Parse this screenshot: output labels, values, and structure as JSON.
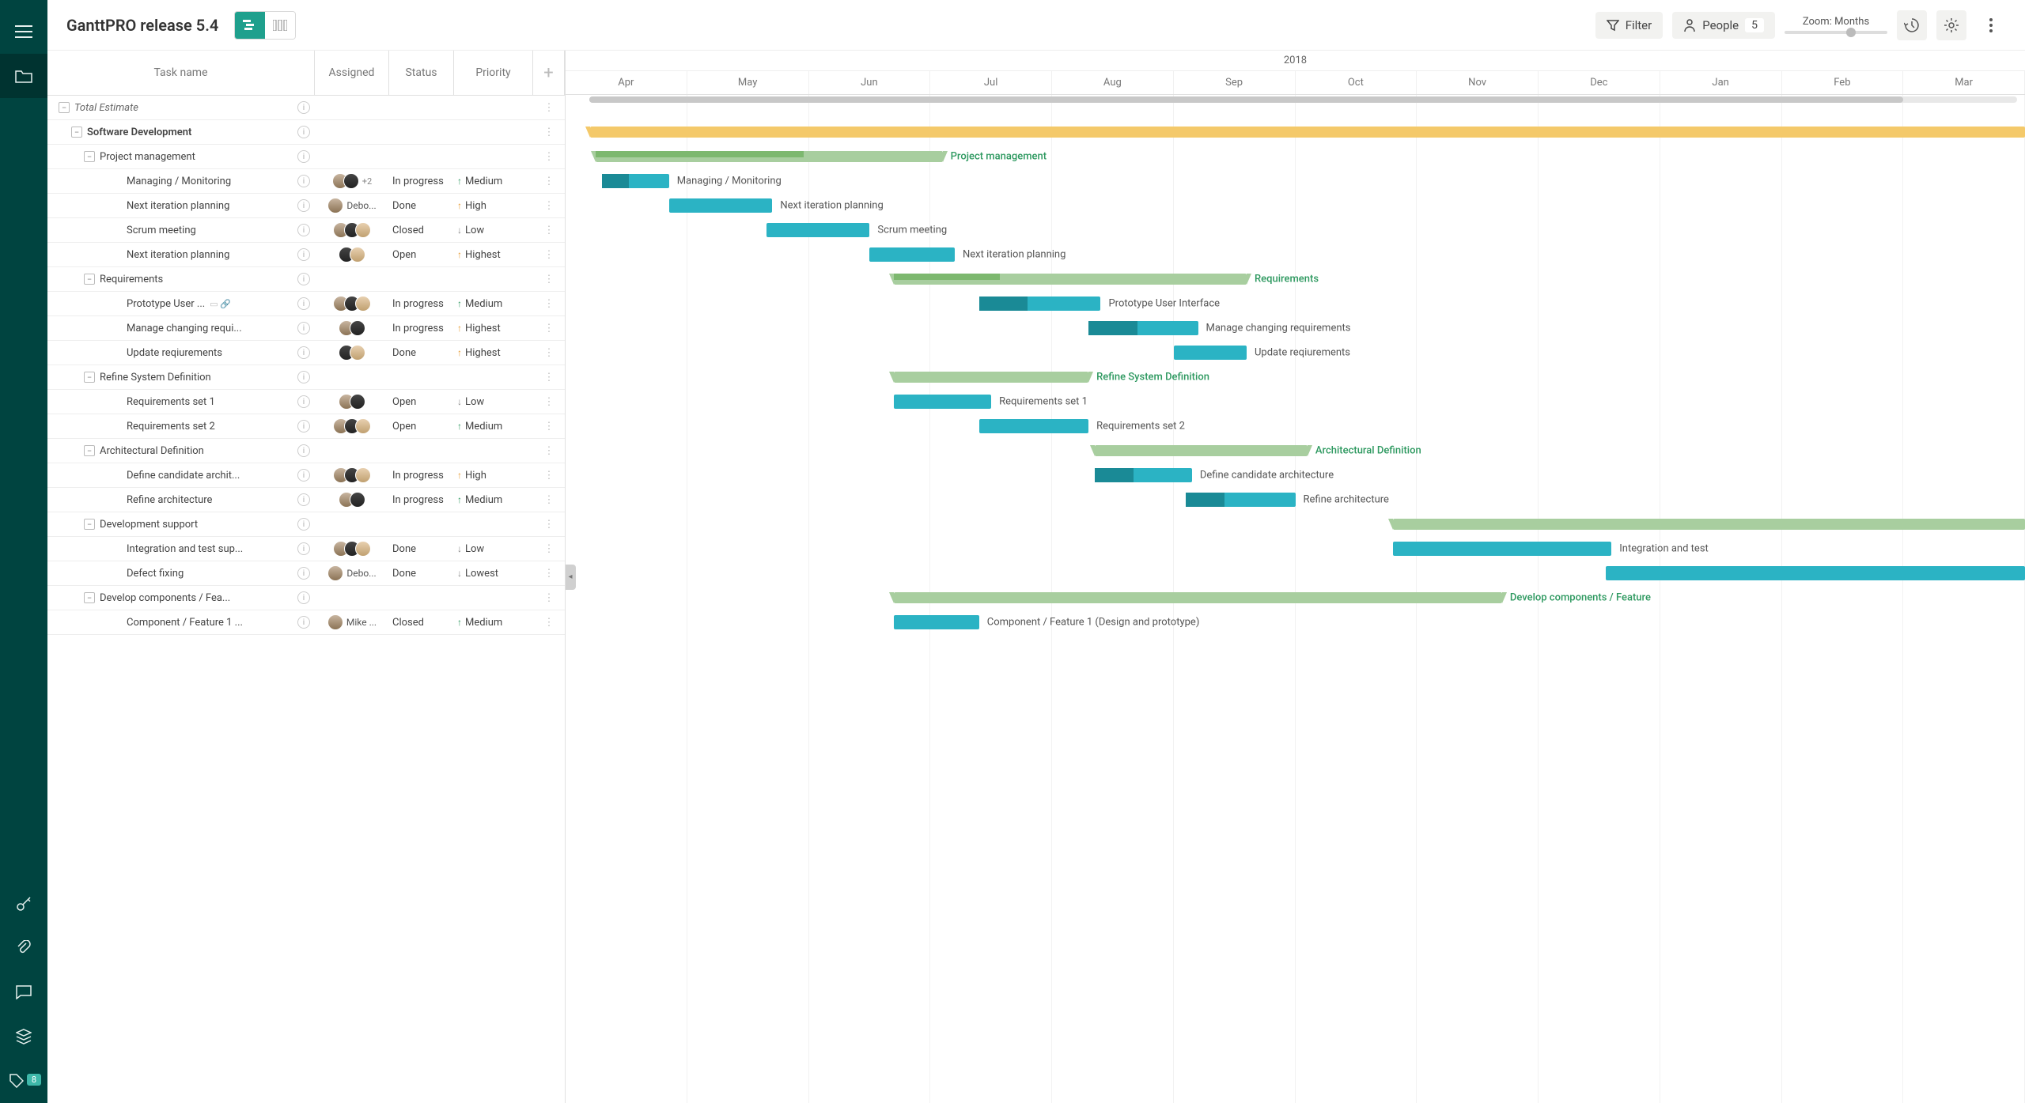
{
  "project_title": "GanttPRO release 5.4",
  "topbar": {
    "filter": "Filter",
    "people": "People",
    "people_count": "5",
    "zoom_label": "Zoom: Months"
  },
  "sidebar": {
    "badge": "8"
  },
  "columns": {
    "name": "Task name",
    "assigned": "Assigned",
    "status": "Status",
    "priority": "Priority"
  },
  "timeline": {
    "year": "2018",
    "months": [
      "Apr",
      "May",
      "Jun",
      "Jul",
      "Aug",
      "Sep",
      "Oct",
      "Nov",
      "Dec",
      "Jan",
      "Feb",
      "Mar"
    ]
  },
  "chart_data": {
    "type": "gantt",
    "time_axis": {
      "start_month": "Apr 2018",
      "end_month": "Mar 2019",
      "num_cols": 12
    },
    "rows": [
      {
        "id": "total",
        "name": "Total Estimate",
        "indent": 0,
        "type": "scrollbar"
      },
      {
        "id": "soft",
        "name": "Software Development",
        "indent": 1,
        "type": "summary-yellow",
        "start": 0.2,
        "end": 12,
        "progress": 0.55
      },
      {
        "id": "pm",
        "name": "Project management",
        "indent": 2,
        "type": "summary-green",
        "start": 0.25,
        "end": 3.1,
        "progress": 0.6,
        "label_class": "green"
      },
      {
        "id": "mm",
        "name": "Managing / Monitoring",
        "indent": 3,
        "assigned": [
          "a1",
          "a2",
          "+2"
        ],
        "status": "In progress",
        "priority": "Medium",
        "p_arrow": "up-green",
        "type": "task",
        "start": 0.3,
        "end": 0.85,
        "progress": 0.4
      },
      {
        "id": "nip1",
        "name": "Next iteration planning",
        "indent": 3,
        "assigned": [
          "a1",
          "Debo..."
        ],
        "assigned_text": "Debo...",
        "status": "Done",
        "priority": "High",
        "p_arrow": "up-orange",
        "type": "task",
        "start": 0.85,
        "end": 1.7,
        "progress": 0
      },
      {
        "id": "scrum",
        "name": "Scrum meeting",
        "indent": 3,
        "assigned": [
          "a1",
          "a2",
          "a3"
        ],
        "status": "Closed",
        "priority": "Low",
        "p_arrow": "down",
        "type": "task",
        "start": 1.65,
        "end": 2.5,
        "progress": 0
      },
      {
        "id": "nip2",
        "name": "Next iteration planning",
        "indent": 3,
        "assigned": [
          "a2",
          "a3"
        ],
        "status": "Open",
        "priority": "Highest",
        "p_arrow": "up-orange",
        "type": "task",
        "start": 2.5,
        "end": 3.2,
        "progress": 0
      },
      {
        "id": "req",
        "name": "Requirements",
        "indent": 2,
        "type": "summary-green",
        "start": 2.7,
        "end": 5.6,
        "progress": 0.3,
        "label_class": "green"
      },
      {
        "id": "proto",
        "name": "Prototype User ...",
        "indent": 3,
        "assigned": [
          "a1",
          "a2",
          "a3"
        ],
        "status": "In progress",
        "priority": "Medium",
        "p_arrow": "up-green",
        "attach": true,
        "type": "task",
        "start": 3.4,
        "end": 4.4,
        "progress": 0.4,
        "full_label": "Prototype User Interface"
      },
      {
        "id": "mcr",
        "name": "Manage changing requi...",
        "indent": 3,
        "assigned": [
          "a1",
          "a2"
        ],
        "status": "In progress",
        "priority": "Highest",
        "p_arrow": "up-orange",
        "type": "task",
        "start": 4.3,
        "end": 5.2,
        "progress": 0.45,
        "full_label": "Manage changing requirements"
      },
      {
        "id": "upd",
        "name": "Update reqiurements",
        "indent": 3,
        "assigned": [
          "a2",
          "a3"
        ],
        "status": "Done",
        "priority": "Highest",
        "p_arrow": "up-orange",
        "type": "task",
        "start": 5.0,
        "end": 5.6,
        "progress": 0
      },
      {
        "id": "refine",
        "name": "Refine System Definition",
        "indent": 2,
        "type": "summary-green",
        "start": 2.7,
        "end": 4.3,
        "progress": 0,
        "label_class": "green"
      },
      {
        "id": "rs1",
        "name": "Requirements set 1",
        "indent": 3,
        "assigned": [
          "a1",
          "a2"
        ],
        "status": "Open",
        "priority": "Low",
        "p_arrow": "down",
        "type": "task",
        "start": 2.7,
        "end": 3.5,
        "progress": 0
      },
      {
        "id": "rs2",
        "name": "Requirements set 2",
        "indent": 3,
        "assigned": [
          "a1",
          "a2",
          "a3"
        ],
        "status": "Open",
        "priority": "Medium",
        "p_arrow": "up-green",
        "type": "task",
        "start": 3.4,
        "end": 4.3,
        "progress": 0
      },
      {
        "id": "arch",
        "name": "Architectural Definition",
        "indent": 2,
        "type": "summary-green",
        "start": 4.35,
        "end": 6.1,
        "progress": 0,
        "label_class": "green"
      },
      {
        "id": "dca",
        "name": "Define candidate archit...",
        "indent": 3,
        "assigned": [
          "a1",
          "a2",
          "a3"
        ],
        "status": "In progress",
        "priority": "High",
        "p_arrow": "up-orange",
        "type": "task",
        "start": 4.35,
        "end": 5.15,
        "progress": 0.4,
        "full_label": "Define candidate architecture"
      },
      {
        "id": "ra",
        "name": "Refine architecture",
        "indent": 3,
        "assigned": [
          "a1",
          "a2"
        ],
        "status": "In progress",
        "priority": "Medium",
        "p_arrow": "up-green",
        "type": "task",
        "start": 5.1,
        "end": 6.0,
        "progress": 0.35
      },
      {
        "id": "devs",
        "name": "Development support",
        "indent": 2,
        "type": "summary-green",
        "start": 6.8,
        "end": 12,
        "progress": 0,
        "label_class": "green",
        "no_label": true
      },
      {
        "id": "its",
        "name": "Integration and test sup...",
        "indent": 3,
        "assigned": [
          "a1",
          "a2",
          "a3"
        ],
        "status": "Done",
        "priority": "Low",
        "p_arrow": "down",
        "type": "task",
        "start": 6.8,
        "end": 8.6,
        "progress": 0,
        "full_label": "Integration and test"
      },
      {
        "id": "df",
        "name": "Defect fixing",
        "indent": 3,
        "assigned": [
          "a1",
          "Debo..."
        ],
        "assigned_text": "Debo...",
        "status": "Done",
        "priority": "Lowest",
        "p_arrow": "down",
        "type": "task",
        "start": 8.55,
        "end": 12,
        "progress": 0,
        "no_label": true
      },
      {
        "id": "dcf",
        "name": "Develop components / Fea...",
        "indent": 2,
        "type": "summary-green",
        "start": 2.7,
        "end": 7.7,
        "progress": 0,
        "label_class": "green",
        "full_label": "Develop components / Feature",
        "label_right": true
      },
      {
        "id": "cf1",
        "name": "Component / Feature 1 ...",
        "indent": 3,
        "assigned": [
          "a1",
          "Mike ..."
        ],
        "assigned_text": "Mike ...",
        "status": "Closed",
        "priority": "Medium",
        "p_arrow": "up-green",
        "type": "task",
        "start": 2.7,
        "end": 3.4,
        "progress": 0,
        "full_label": "Component / Feature 1 (Design and prototype)"
      }
    ]
  }
}
